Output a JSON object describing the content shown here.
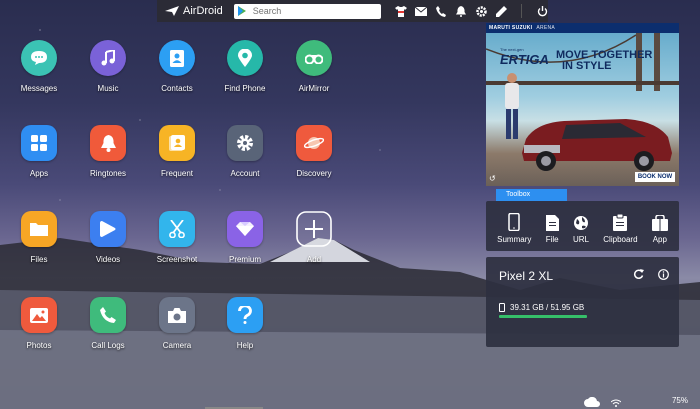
{
  "topbar": {
    "logo_text": "AirDroid",
    "search_placeholder": "Search",
    "icons": [
      "tshirt-icon",
      "mail-icon",
      "phone-icon",
      "bell-icon",
      "gear-icon",
      "edit-icon",
      "power-icon"
    ]
  },
  "apps": [
    {
      "label": "Messages",
      "icon": "chat-icon",
      "color": "#3bc3b4"
    },
    {
      "label": "Music",
      "icon": "music-note-icon",
      "color": "#7a62d8"
    },
    {
      "label": "Contacts",
      "icon": "contacts-icon",
      "color": "#2c9ff3"
    },
    {
      "label": "Find Phone",
      "icon": "location-pin-icon",
      "color": "#26b8a9"
    },
    {
      "label": "AirMirror",
      "icon": "binoculars-icon",
      "color": "#3fbb7c"
    },
    {
      "label": "Apps",
      "icon": "grid-icon",
      "color": "#2f8ef2"
    },
    {
      "label": "Ringtones",
      "icon": "bell-icon",
      "color": "#f05a3a"
    },
    {
      "label": "Frequent",
      "icon": "frequent-contact-icon",
      "color": "#f7b425"
    },
    {
      "label": "Account",
      "icon": "gear-icon",
      "color": "#596478"
    },
    {
      "label": "Discovery",
      "icon": "planet-icon",
      "color": "#ef5a3d"
    },
    {
      "label": "Files",
      "icon": "folder-icon",
      "color": "#f7a625"
    },
    {
      "label": "Videos",
      "icon": "play-icon",
      "color": "#3c7ff0"
    },
    {
      "label": "Screenshot",
      "icon": "scissors-icon",
      "color": "#32b5ec"
    },
    {
      "label": "Premium",
      "icon": "diamond-icon",
      "color": "#8a63e6"
    },
    {
      "label": "Add",
      "icon": "plus-icon",
      "color": "transparent"
    },
    {
      "label": "Photos",
      "icon": "image-icon",
      "color": "#ef5a3d"
    },
    {
      "label": "Call Logs",
      "icon": "phone-icon",
      "color": "#3fbb7c"
    },
    {
      "label": "Camera",
      "icon": "camera-icon",
      "color": "#6c7589"
    },
    {
      "label": "Help",
      "icon": "question-icon",
      "color": "#2c9ff3"
    }
  ],
  "ad": {
    "brand": "MARUTI SUZUKI",
    "brand_sub": "ARENA",
    "model": "ERTIGA",
    "model_sub": "The next-gen",
    "tagline_1": "MOVE TOGETHER",
    "tagline_2": "IN STYLE",
    "cta": "BOOK NOW"
  },
  "toolbox": {
    "tab_label": "Toolbox",
    "items": [
      {
        "label": "Summary",
        "icon": "phone-icon"
      },
      {
        "label": "File",
        "icon": "file-icon"
      },
      {
        "label": "URL",
        "icon": "globe-icon"
      },
      {
        "label": "Clipboard",
        "icon": "clipboard-icon"
      },
      {
        "label": "App",
        "icon": "app-store-icon"
      }
    ]
  },
  "device": {
    "name": "Pixel 2 XL",
    "storage": "39.31 GB / 51.95 GB",
    "storage_used_fraction": 0.757
  },
  "status": {
    "zoom": "75%"
  }
}
